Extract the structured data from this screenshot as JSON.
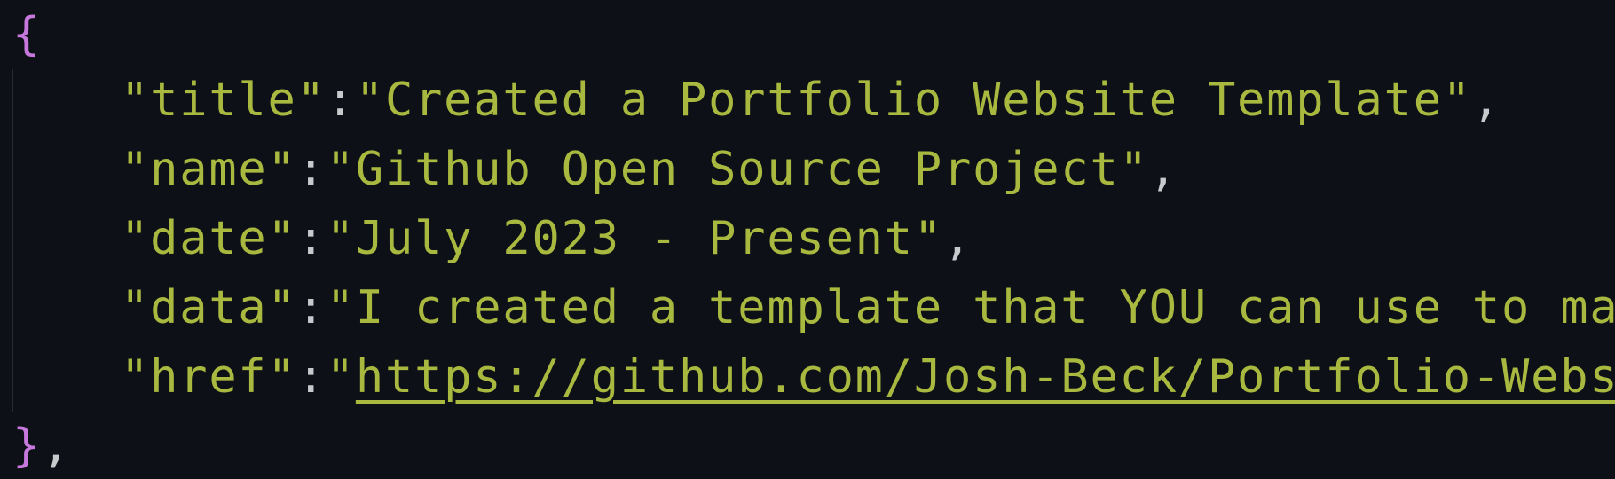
{
  "editor": {
    "open_brace": "{",
    "close_brace": "}",
    "close_comma": ",",
    "entries": [
      {
        "key": "\"title\"",
        "sep": ":",
        "value": "\"Created a Portfolio Website Template\"",
        "comma": ","
      },
      {
        "key": "\"name\"",
        "sep": ":",
        "value": "\"Github Open Source Project\"",
        "comma": ","
      },
      {
        "key": "\"date\"",
        "sep": ":",
        "value": "\"July 2023 - Present\"",
        "comma": ","
      },
      {
        "key": "\"data\"",
        "sep": ":",
        "value": "\"I created a template that YOU can use to make",
        "comma": ""
      },
      {
        "key": "\"href\"",
        "sep": ":",
        "quote": "\"",
        "link": "https://github.com/Josh-Beck/Portfolio-Website",
        "comma": ""
      }
    ]
  },
  "colors": {
    "background": "#0d1117",
    "string": "#a9b940",
    "brace": "#c678dd",
    "punctuation": "#c7c9cc"
  }
}
